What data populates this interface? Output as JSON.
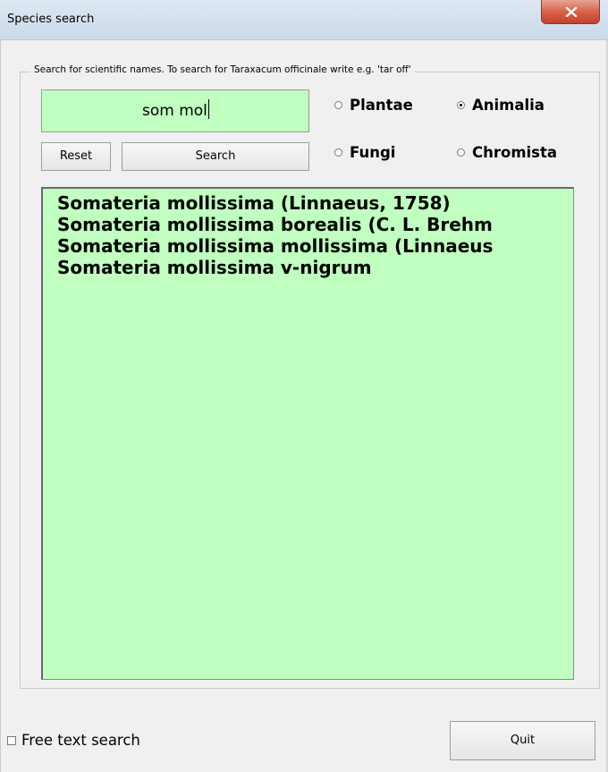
{
  "window": {
    "title": "Species search"
  },
  "form": {
    "legend": "Search for scientific names. To search for Taraxacum officinale write e.g. 'tar off'",
    "search_value": "som mol",
    "reset_label": "Reset",
    "search_label": "Search",
    "quit_label": "Quit",
    "free_text_label": "Free text search",
    "free_text_checked": false
  },
  "kingdoms": [
    {
      "label": "Plantae",
      "checked": false
    },
    {
      "label": "Animalia",
      "checked": true
    },
    {
      "label": "Fungi",
      "checked": false
    },
    {
      "label": "Chromista",
      "checked": false
    }
  ],
  "results": [
    "Somateria mollissima  (Linnaeus, 1758)",
    "Somateria mollissima borealis (C. L. Brehm",
    "Somateria mollissima mollissima (Linnaeus",
    "Somateria mollissima v-nigrum"
  ],
  "colors": {
    "field_background": "#c0ffc0",
    "window_background": "#f0f0f0",
    "close_button": "#c7503a"
  },
  "icons": {
    "close": "close-icon"
  }
}
